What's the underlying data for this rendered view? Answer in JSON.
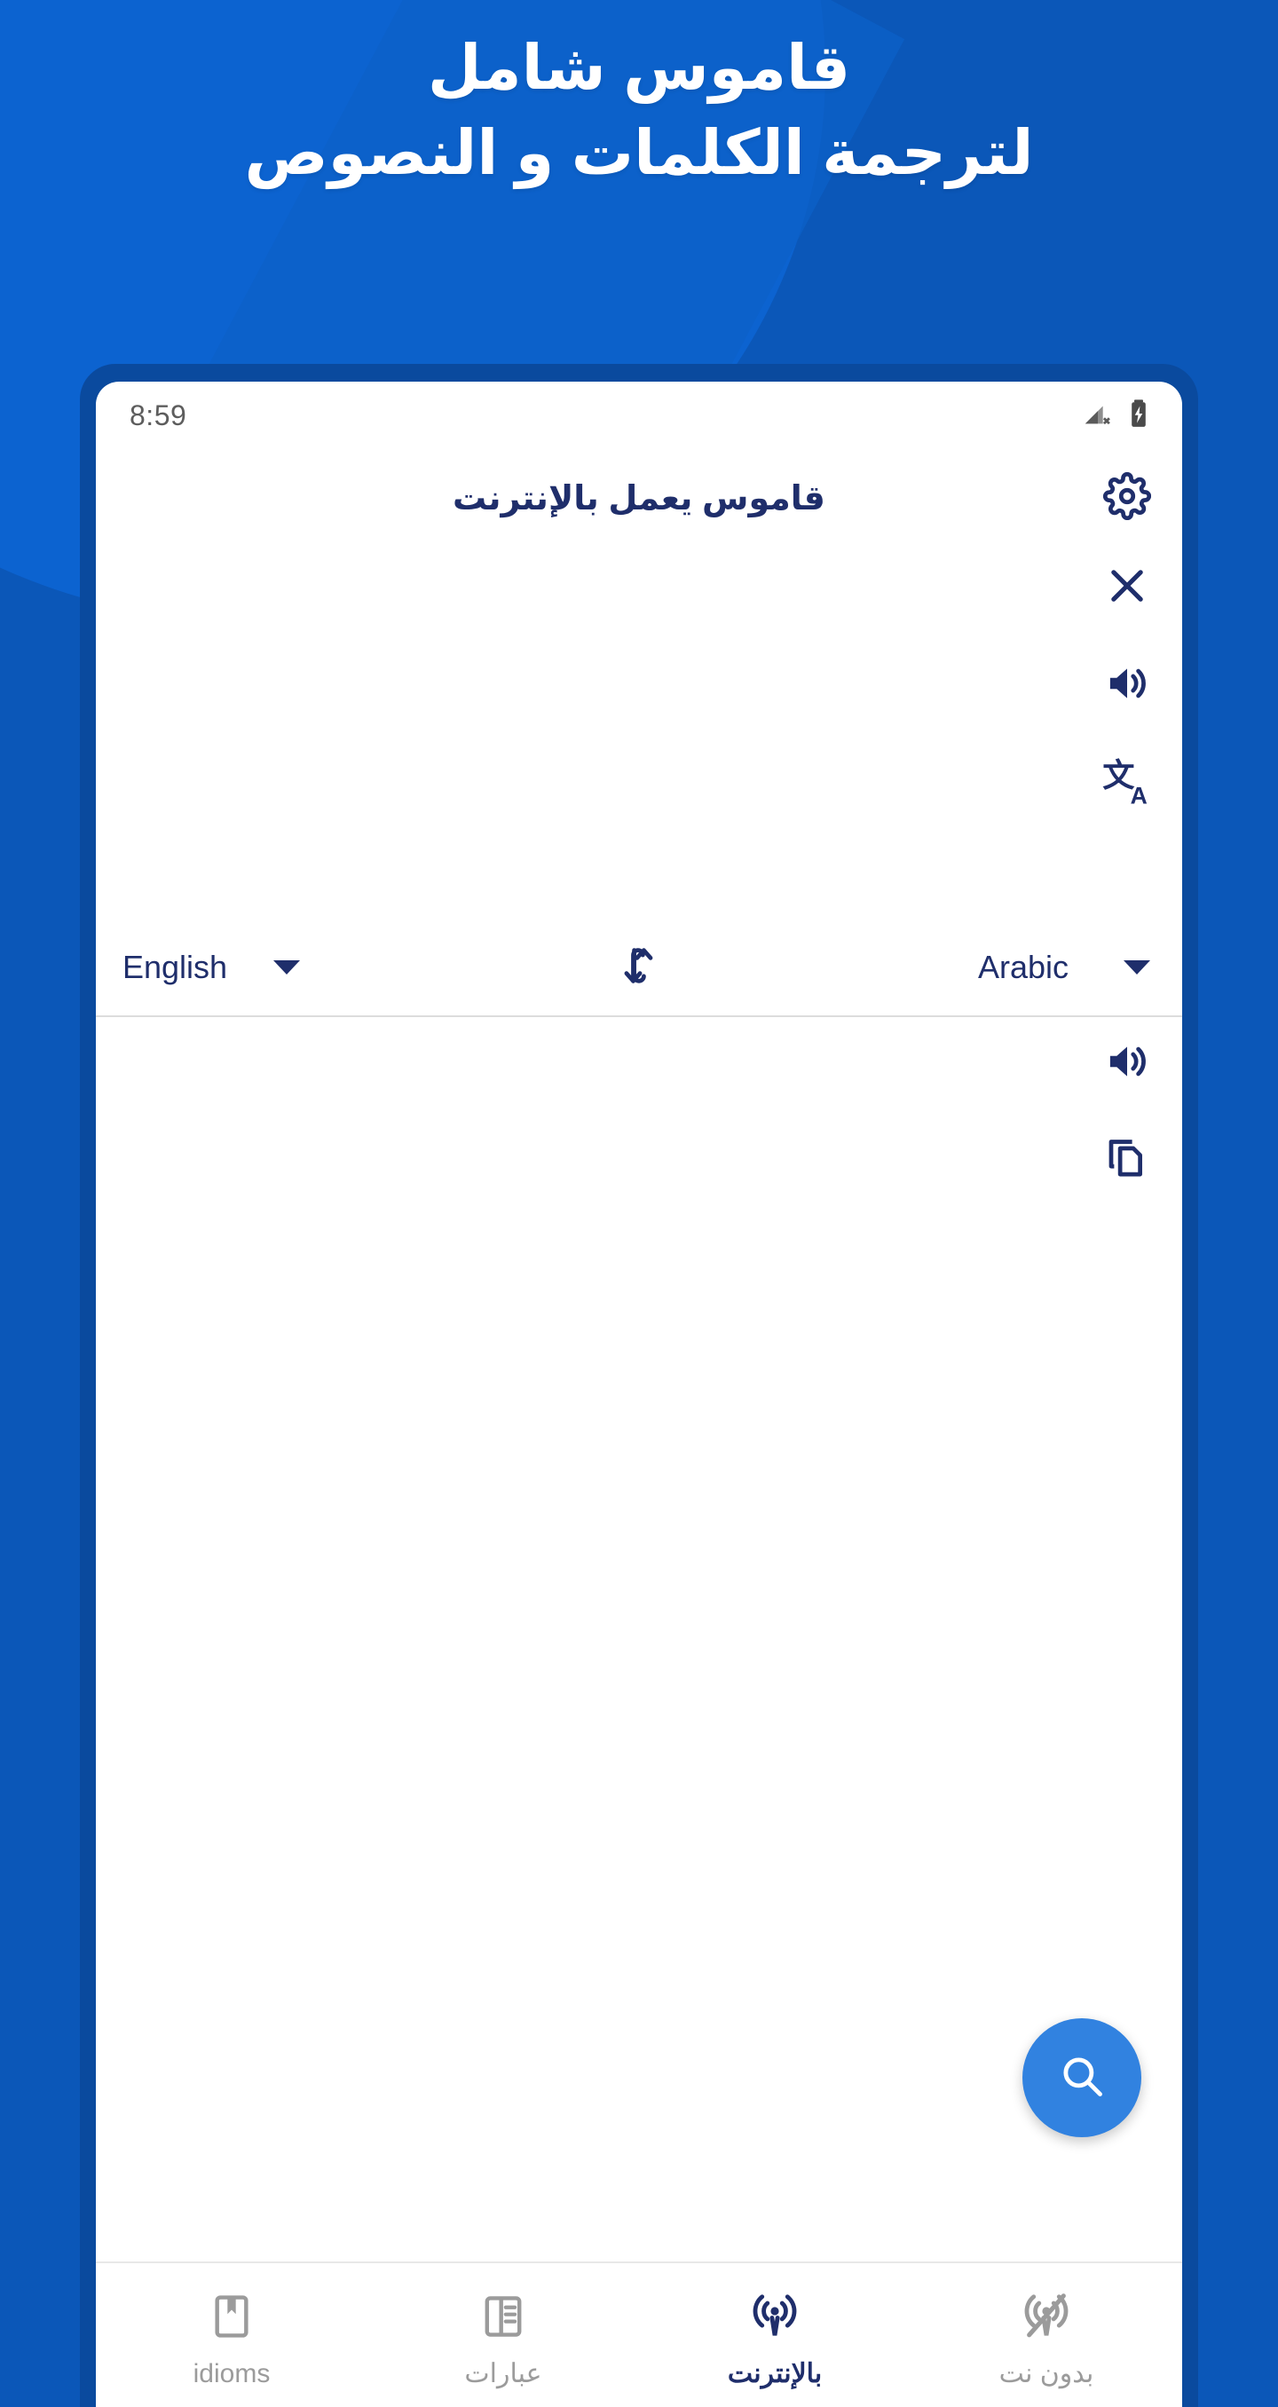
{
  "promo": {
    "headline_line1": "قاموس شامل",
    "headline_line2": "لترجمة الكلمات و النصوص",
    "bg_color": "#0B57B8",
    "bg_accent_color": "#0C63D0",
    "frame_color": "#0A4A9E"
  },
  "status_bar": {
    "time": "8:59",
    "signal_icon": "signal-no-sim-icon",
    "battery_icon": "battery-charging-icon"
  },
  "app_bar": {
    "title": "قاموس يعمل بالإنترنت",
    "settings_icon": "gear-icon"
  },
  "source_panel": {
    "input_value": "",
    "input_placeholder": "",
    "actions": [
      {
        "name": "clear-button",
        "icon": "close-icon"
      },
      {
        "name": "speak-source-button",
        "icon": "volume-up-icon"
      },
      {
        "name": "translate-button",
        "icon": "translate-icon"
      }
    ]
  },
  "language_row": {
    "source_language": "English",
    "target_language": "Arabic",
    "swap_icon": "swap-vertical-icon",
    "caret_icon": "chevron-down-icon"
  },
  "result_panel": {
    "text": "",
    "actions": [
      {
        "name": "speak-result-button",
        "icon": "volume-up-icon"
      },
      {
        "name": "copy-result-button",
        "icon": "copy-icon"
      }
    ]
  },
  "fab": {
    "label": "",
    "icon": "search-icon",
    "color": "#3182E0"
  },
  "bottom_nav": {
    "active_color": "#1F2E6B",
    "inactive_color": "#9b9b9b",
    "items": [
      {
        "label": "idioms",
        "icon": "bookmark-book-icon",
        "active": false
      },
      {
        "label": "عبارات",
        "icon": "phrases-book-icon",
        "active": false
      },
      {
        "label": "بالإنترنت",
        "icon": "online-signal-icon",
        "active": true
      },
      {
        "label": "بدون نت",
        "icon": "offline-signal-icon",
        "active": false
      }
    ]
  }
}
